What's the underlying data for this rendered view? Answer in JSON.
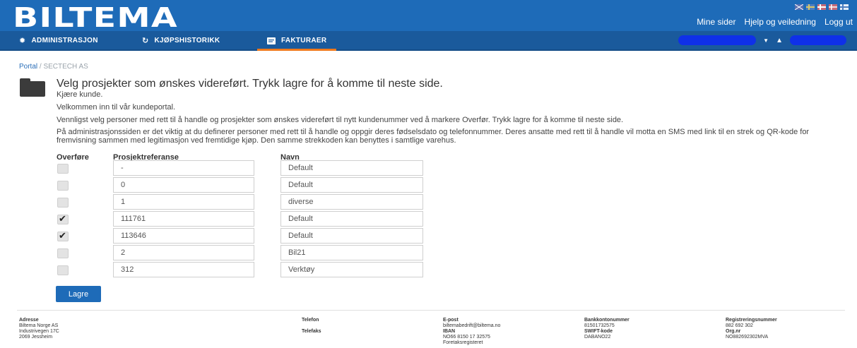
{
  "header": {
    "logo": "BILTEMA",
    "links": [
      "Mine sider",
      "Hjelp og veiledning",
      "Logg ut"
    ]
  },
  "nav": {
    "items": [
      {
        "label": "ADMINISTRASJON",
        "icon": "gear-icon"
      },
      {
        "label": "KJØPSHISTORIKK",
        "icon": "history-icon"
      },
      {
        "label": "FAKTURAER",
        "icon": "invoice-icon"
      }
    ],
    "active_index": 2
  },
  "breadcrumb": {
    "home": "Portal",
    "separator": "/",
    "current": "SECTECH AS"
  },
  "main": {
    "title": "Velg prosjekter som ønskes videreført. Trykk lagre for å komme til neste side.",
    "greeting": "Kjære kunde.",
    "welcome": "Velkommen inn til vår kundeportal.",
    "instruction": "Vennligst velg personer med rett til å handle og prosjekter som ønskes videreført til nytt kundenummer ved å markere Overfør. Trykk lagre for å komme til neste side.",
    "info": "På administrasjonssiden er det viktig at du definerer personer med rett til å handle og oppgir deres fødselsdato og telefonnummer. Deres ansatte med rett til å handle vil motta en SMS med link til en strek og QR-kode for fremvisning sammen med legitimasjon ved fremtidige kjøp. Den samme strekkoden kan benyttes i samtlige varehus."
  },
  "table": {
    "headers": {
      "transfer": "Overføre",
      "ref": "Prosjektreferanse",
      "name": "Navn"
    },
    "rows": [
      {
        "checked": false,
        "ref": "-",
        "name": "Default"
      },
      {
        "checked": false,
        "ref": "0",
        "name": "Default"
      },
      {
        "checked": false,
        "ref": "1",
        "name": "diverse"
      },
      {
        "checked": true,
        "ref": "111761",
        "name": "Default"
      },
      {
        "checked": true,
        "ref": "113646",
        "name": "Default"
      },
      {
        "checked": false,
        "ref": "2",
        "name": "Bil21"
      },
      {
        "checked": false,
        "ref": "312",
        "name": "Verktøy"
      }
    ]
  },
  "save_label": "Lagre",
  "footer": {
    "address": {
      "heading": "Adresse",
      "lines": [
        "Biltema Norge AS",
        "Industrivegen 17C",
        "2069 Jessheim"
      ]
    },
    "phone": {
      "heading": "Telefon",
      "fax_heading": "Telefaks"
    },
    "email": {
      "heading": "E-post",
      "value": "biltemabedrift@biltema.no",
      "iban_heading": "IBAN",
      "iban": "NO66 8150 17 32575",
      "register": "Foretaksregisteret"
    },
    "bank": {
      "heading": "Bankkontonummer",
      "value": "81501732575",
      "swift_heading": "SWIFT-kode",
      "swift": "DABANO22"
    },
    "registration": {
      "heading": "Registreringsnummer",
      "value": "882 692 302",
      "org_heading": "Org.nr",
      "org": "NO882692302MVA"
    }
  },
  "colors": {
    "brand_blue": "#1e6bb8",
    "nav_blue": "#1a5a9c",
    "active_orange": "#f07a1c",
    "redaction": "#0f30e8"
  }
}
